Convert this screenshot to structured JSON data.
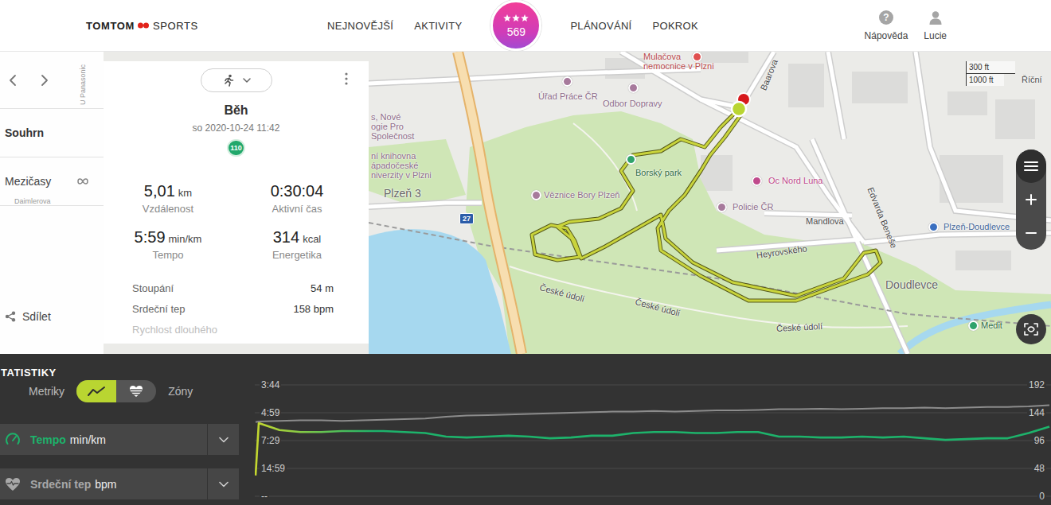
{
  "header": {
    "logo": {
      "brand": "TOMTOM",
      "product": "SPORTS"
    },
    "nav": [
      {
        "label": "NEJNOVĚJŠÍ",
        "selected": false
      },
      {
        "label": "AKTIVITY",
        "selected": false
      },
      {
        "label": "PLÁNOVÁNÍ",
        "selected": false
      },
      {
        "label": "POKROK",
        "selected": false
      }
    ],
    "score": {
      "value": "569",
      "stars": 3
    },
    "help": {
      "icon": "?",
      "label": "Nápověda"
    },
    "user": {
      "label": "Lucie"
    }
  },
  "sidebar": {
    "items": [
      {
        "label": "Souhrn",
        "selected": true
      },
      {
        "label": "Mezičasy",
        "selected": false
      }
    ],
    "share": "Sdílet"
  },
  "activity": {
    "type": "Běh",
    "date": "so 2020-10-24 11:42",
    "badge": "110",
    "stats": [
      {
        "value": "5,01",
        "unit": "km",
        "label": "Vzdálenost"
      },
      {
        "value": "0:30:04",
        "label": "Aktivní čas"
      },
      {
        "value": "5:59",
        "unit": "min/km",
        "label": "Tempo"
      },
      {
        "value": "314",
        "unit": "kcal",
        "label": "Energetika"
      }
    ],
    "details": [
      {
        "label": "Stoupání",
        "value": "54 m",
        "faded": false
      },
      {
        "label": "Srdeční tep",
        "value": "158 bpm",
        "faded": false
      },
      {
        "label": "Rychlost dlouhého",
        "faded": true
      }
    ]
  },
  "map": {
    "labels": [
      {
        "text": "Mulačova",
        "kind": "hospital"
      },
      {
        "text": "nemocnice v Plzni",
        "kind": "hospital"
      },
      {
        "text": "Úřad Práce ČR",
        "kind": "poi"
      },
      {
        "text": "Odbor Dopravy",
        "kind": "poi"
      },
      {
        "text": "Baarova",
        "kind": "street"
      },
      {
        "text": "Říční",
        "kind": "street"
      },
      {
        "text": "s, Nové",
        "kind": "poi"
      },
      {
        "text": "ogie Pro",
        "kind": "poi"
      },
      {
        "text": "Společnost",
        "kind": "poi"
      },
      {
        "text": "ní knihovna",
        "kind": "poi"
      },
      {
        "text": "ápadočeské",
        "kind": "poi"
      },
      {
        "text": "niverzity v Plzni",
        "kind": "poi"
      },
      {
        "text": "Plzeň 3",
        "kind": "district"
      },
      {
        "text": "Borský park",
        "kind": "park"
      },
      {
        "text": "Věznice Bory Plzeň",
        "kind": "poi"
      },
      {
        "text": "Oc Nord Luna",
        "kind": "shop"
      },
      {
        "text": "Policie ČR",
        "kind": "poi"
      },
      {
        "text": "Mandlova",
        "kind": "street"
      },
      {
        "text": "Heyrovského",
        "kind": "street"
      },
      {
        "text": "Edvarda Beneše",
        "kind": "street"
      },
      {
        "text": "Plzeň-Doudlevce",
        "kind": "transit"
      },
      {
        "text": "Doudlevce",
        "kind": "district"
      },
      {
        "text": "České údolí",
        "kind": "street"
      },
      {
        "text": "České údolí",
        "kind": "street"
      },
      {
        "text": "České údolí",
        "kind": "street"
      },
      {
        "text": "Medit",
        "kind": "park"
      },
      {
        "text": "Daimlerova",
        "kind": "faint"
      },
      {
        "text": "U Panasonic",
        "kind": "faint"
      }
    ],
    "road_shield": "27",
    "scale": [
      "300 ft",
      "1000 ft"
    ]
  },
  "stats": {
    "title": "TATISTIKY",
    "view_toggle": {
      "left_label": "Metriky",
      "right_label": "Zóny",
      "options": [
        {
          "kind": "metrics",
          "selected": true
        },
        {
          "kind": "zones",
          "selected": false
        }
      ]
    },
    "metrics": [
      {
        "label": "Tempo",
        "unit": "min/km",
        "color": "#1db36b",
        "expanded": false
      },
      {
        "label": "Srdeční tep",
        "unit": "bpm",
        "color": "#a8a8a8",
        "expanded": false
      }
    ],
    "chart": {
      "left_ticks": [
        "3:44",
        "4:59",
        "7:29",
        "14:59",
        "--"
      ],
      "right_ticks": [
        "192",
        "144",
        "96",
        "48",
        "0"
      ],
      "series": [
        {
          "name": "Tempo",
          "unit": "min/km",
          "axis": "left",
          "color": "#1db36b",
          "values": [
            20.0,
            5.7,
            6.3,
            6.5,
            6.5,
            6.4,
            6.4,
            6.4,
            6.5,
            6.6,
            7.0,
            7.1,
            7.0,
            6.9,
            7.0,
            7.2,
            7.1,
            6.9,
            6.9,
            6.6,
            6.5,
            6.5,
            6.6,
            6.6,
            6.5,
            6.5,
            7.0,
            7.0,
            7.1,
            7.1,
            7.0,
            7.1,
            7.0,
            7.2,
            7.4,
            7.3,
            7.2,
            7.2,
            6.6,
            6.0
          ]
        },
        {
          "name": "Srdeční tep",
          "unit": "bpm",
          "axis": "right",
          "color": "#8c8c8c",
          "values": [
            128,
            129,
            130,
            131,
            131,
            130,
            131,
            132,
            133,
            134,
            137,
            139,
            140,
            141,
            142,
            143,
            144,
            145,
            146,
            146,
            147,
            146,
            147,
            148,
            148,
            149,
            150,
            150,
            151,
            150,
            151,
            152,
            152,
            153,
            152,
            153,
            154,
            154,
            155,
            157
          ]
        }
      ]
    }
  }
}
